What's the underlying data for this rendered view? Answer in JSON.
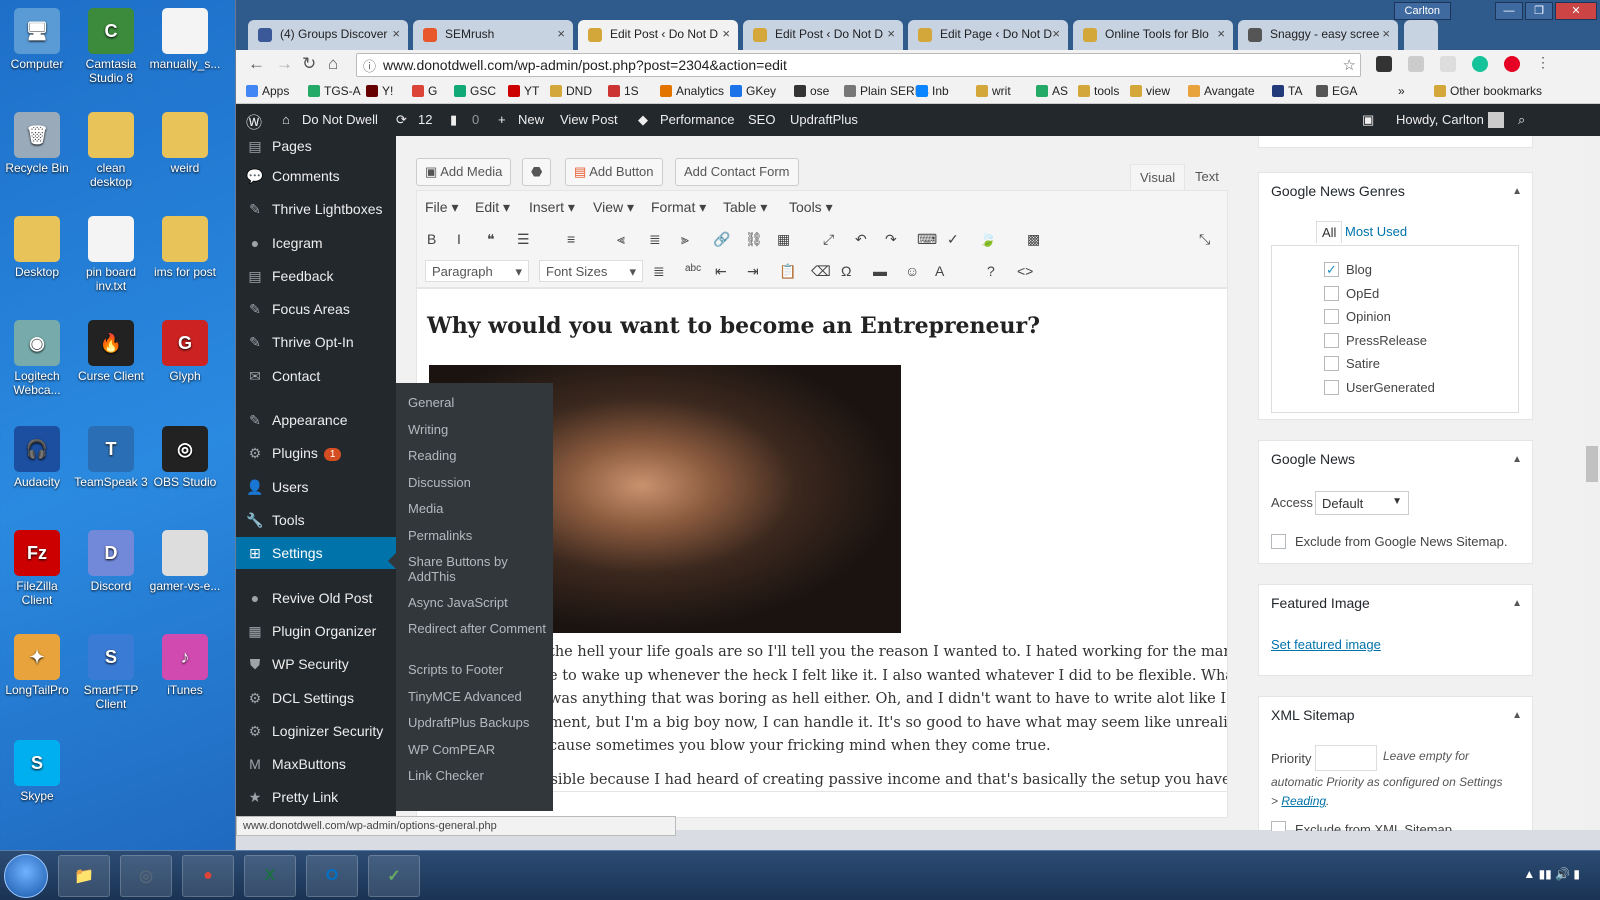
{
  "desktop": {
    "icons": [
      {
        "label": "Computer",
        "color": "#5b9bd5",
        "glyph": "🖥"
      },
      {
        "label": "Camtasia Studio 8",
        "color": "#3c8a3c",
        "glyph": "C"
      },
      {
        "label": "manually_s...",
        "color": "#f4f4f4",
        "glyph": ""
      },
      {
        "label": "Recycle Bin",
        "color": "#9ab",
        "glyph": "🗑"
      },
      {
        "label": "clean desktop",
        "color": "#e8c35a",
        "glyph": ""
      },
      {
        "label": "weird",
        "color": "#e8c35a",
        "glyph": ""
      },
      {
        "label": "Desktop",
        "color": "#e8c35a",
        "glyph": ""
      },
      {
        "label": "pin board inv.txt",
        "color": "#f4f4f4",
        "glyph": ""
      },
      {
        "label": "ims for post",
        "color": "#e8c35a",
        "glyph": ""
      },
      {
        "label": "Logitech Webca...",
        "color": "#7aa",
        "glyph": "◉"
      },
      {
        "label": "Curse Client",
        "color": "#222",
        "glyph": "🔥"
      },
      {
        "label": "Glyph",
        "color": "#c22",
        "glyph": "G"
      },
      {
        "label": "Audacity",
        "color": "#1c4fa0",
        "glyph": "🎧"
      },
      {
        "label": "TeamSpeak 3",
        "color": "#2a6fb5",
        "glyph": "T"
      },
      {
        "label": "OBS Studio",
        "color": "#222",
        "glyph": "◎"
      },
      {
        "label": "FileZilla Client",
        "color": "#c00",
        "glyph": "Fz"
      },
      {
        "label": "Discord",
        "color": "#7289da",
        "glyph": "D"
      },
      {
        "label": "gamer-vs-e...",
        "color": "#ddd",
        "glyph": ""
      },
      {
        "label": "LongTailPro",
        "color": "#e8a33c",
        "glyph": "✦"
      },
      {
        "label": "SmartFTP Client",
        "color": "#3a7bd5",
        "glyph": "S"
      },
      {
        "label": "iTunes",
        "color": "#d04ab0",
        "glyph": "♪"
      },
      {
        "label": "Skype",
        "color": "#00aff0",
        "glyph": "S"
      }
    ]
  },
  "browser": {
    "tabs": [
      {
        "title": "(4) Groups Discover",
        "color": "#3b5998"
      },
      {
        "title": "SEMrush",
        "color": "#e8572a"
      },
      {
        "title": "Edit Post ‹ Do Not D",
        "color": "#d4a73a"
      },
      {
        "title": "Edit Post ‹ Do Not D",
        "color": "#d4a73a"
      },
      {
        "title": "Edit Page ‹ Do Not D",
        "color": "#d4a73a"
      },
      {
        "title": "Online Tools for Blo",
        "color": "#d4a73a"
      },
      {
        "title": "Snaggy - easy scree",
        "color": "#555"
      }
    ],
    "user": "Carlton",
    "url": "www.donotdwell.com/wp-admin/post.php?post=2304&action=edit",
    "bookmarks": [
      "Apps",
      "TGS-A",
      "Y!",
      "G",
      "GSC",
      "YT",
      "DND",
      "1S",
      "Analytics",
      "GKey",
      "ose",
      "Plain SERPs",
      "Inb",
      "writ",
      "AS",
      "tools",
      "view",
      "Avangate",
      "TA",
      "EGA",
      "»",
      "Other bookmarks"
    ]
  },
  "wpbar": {
    "site": "Do Not Dwell",
    "updates": "12",
    "comments": "0",
    "new": "New",
    "view_post": "View Post",
    "performance": "Performance",
    "seo": "SEO",
    "updraft": "UpdraftPlus",
    "howdy": "Howdy, Carlton"
  },
  "sidebar": {
    "items": [
      {
        "label": "Pages",
        "icon": "▤"
      },
      {
        "label": "Comments",
        "icon": "💬"
      },
      {
        "label": "Thrive Lightboxes",
        "icon": "✎"
      },
      {
        "label": "Icegram",
        "icon": "●"
      },
      {
        "label": "Feedback",
        "icon": "▤"
      },
      {
        "label": "Focus Areas",
        "icon": "✎"
      },
      {
        "label": "Thrive Opt-In",
        "icon": "✎"
      },
      {
        "label": "Contact",
        "icon": "✉"
      },
      {
        "label": "Appearance",
        "icon": "✎"
      },
      {
        "label": "Plugins",
        "icon": "⚙",
        "badge": "1"
      },
      {
        "label": "Users",
        "icon": "👤"
      },
      {
        "label": "Tools",
        "icon": "🔧"
      },
      {
        "label": "Settings",
        "icon": "⊞"
      },
      {
        "label": "Revive Old Post",
        "icon": "●"
      },
      {
        "label": "Plugin Organizer",
        "icon": "▦"
      },
      {
        "label": "WP Security",
        "icon": "⛊"
      },
      {
        "label": "DCL Settings",
        "icon": "⚙"
      },
      {
        "label": "Loginizer Security",
        "icon": "⚙"
      },
      {
        "label": "MaxButtons",
        "icon": "M"
      },
      {
        "label": "Pretty Link",
        "icon": "★"
      }
    ]
  },
  "settings_menu": [
    "General",
    "Writing",
    "Reading",
    "Discussion",
    "Media",
    "Permalinks",
    "Share Buttons by AddThis",
    "Async JavaScript",
    "Redirect after Comment",
    "Scripts to Footer",
    "TinyMCE Advanced",
    "UpdraftPlus Backups",
    "WP ComPEAR",
    "Link Checker"
  ],
  "editor": {
    "add_media": "Add Media",
    "add_button": "Add Button",
    "add_contact": "Add Contact Form",
    "tab_visual": "Visual",
    "tab_text": "Text",
    "menus": [
      "File",
      "Edit",
      "Insert",
      "View",
      "Format",
      "Table",
      "Tools"
    ],
    "paragraph": "Paragraph",
    "font_sizes": "Font Sizes",
    "heading": "Why would you want to become an Entrepreneur?",
    "lines": [
      "the hell your life goals are so I'll tell you the reason I wanted to. I hated working for the man 😊.",
      "e to wake up whenever the heck I felt like it. I also wanted whatever I did to be flexible. What I",
      "was anything that was boring as hell either. Oh, and I didn't want to have to write alot like I am",
      "ment, but I'm a big boy now, I can handle it. It's so good to have what may seem like unrealistic",
      "cause sometimes you blow your fricking mind when they come true.",
      "ssible because I had heard of creating passive income and that's basically the setup you have"
    ],
    "path": "p"
  },
  "right": {
    "genres": {
      "title": "Google News Genres",
      "tab_all": "All",
      "tab_used": "Most Used",
      "options": [
        {
          "label": "Blog",
          "checked": true
        },
        {
          "label": "OpEd",
          "checked": false
        },
        {
          "label": "Opinion",
          "checked": false
        },
        {
          "label": "PressRelease",
          "checked": false
        },
        {
          "label": "Satire",
          "checked": false
        },
        {
          "label": "UserGenerated",
          "checked": false
        }
      ]
    },
    "gnews": {
      "title": "Google News",
      "access_label": "Access",
      "access_value": "Default",
      "exclude": "Exclude from Google News Sitemap."
    },
    "featured": {
      "title": "Featured Image",
      "link": "Set featured image"
    },
    "xml": {
      "title": "XML Sitemap",
      "priority": "Priority",
      "hint1": "Leave empty for",
      "hint2": "automatic Priority as configured on Settings",
      "hint3": "> ",
      "hint_link": "Reading",
      "hint4": ".",
      "exclude": "Exclude from XML Sitemap"
    }
  },
  "status_url": "www.donotdwell.com/wp-admin/options-general.php",
  "taskbar": {
    "apps": [
      {
        "label": "📁",
        "color": "#e8c35a"
      },
      {
        "label": "◎",
        "color": "#567"
      },
      {
        "label": "●",
        "color": "#db4437"
      },
      {
        "label": "X",
        "color": "#1d7044"
      },
      {
        "label": "O",
        "color": "#0072c6"
      },
      {
        "label": "✓",
        "color": "#6a6"
      }
    ]
  }
}
